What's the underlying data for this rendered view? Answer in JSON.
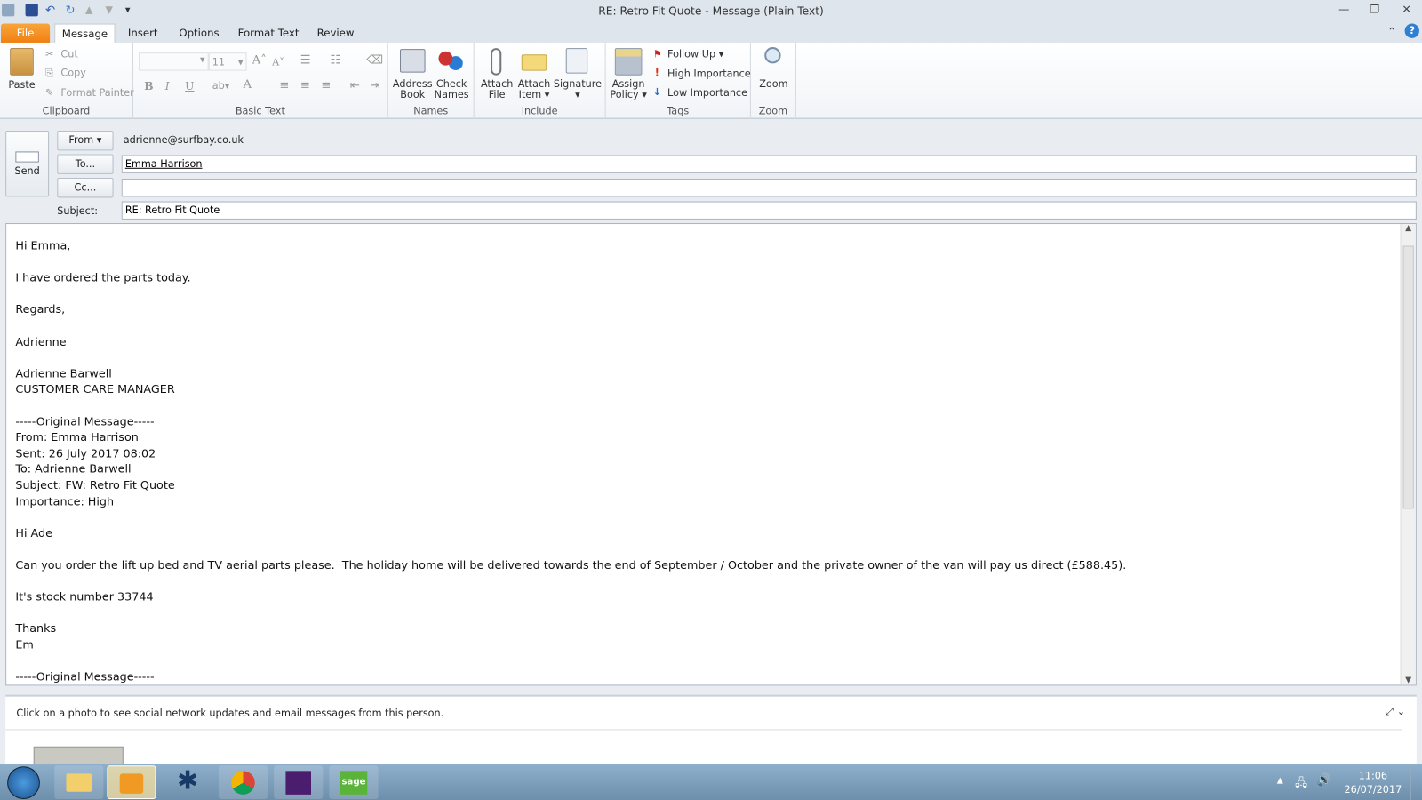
{
  "window": {
    "title": "RE: Retro Fit Quote  -  Message (Plain Text)"
  },
  "tabs": [
    {
      "label": "File"
    },
    {
      "label": "Message"
    },
    {
      "label": "Insert"
    },
    {
      "label": "Options"
    },
    {
      "label": "Format Text"
    },
    {
      "label": "Review"
    }
  ],
  "ribbon": {
    "clipboard": {
      "label": "Clipboard",
      "paste": "Paste",
      "cut": "Cut",
      "copy": "Copy",
      "format_painter": "Format Painter"
    },
    "basic_text": {
      "label": "Basic Text",
      "font_size": "11",
      "bold": "B",
      "italic": "I",
      "underline": "U",
      "font_color": "A"
    },
    "names": {
      "label": "Names",
      "address_book": [
        "Address",
        "Book"
      ],
      "check_names": [
        "Check",
        "Names"
      ]
    },
    "include": {
      "label": "Include",
      "attach_file": [
        "Attach",
        "File"
      ],
      "attach_item": [
        "Attach",
        "Item ▾"
      ],
      "signature": "Signature"
    },
    "tags": {
      "label": "Tags",
      "assign_policy": [
        "Assign",
        "Policy ▾"
      ],
      "follow_up": "Follow Up",
      "high_importance": "High Importance",
      "low_importance": "Low Importance"
    },
    "zoom": {
      "label": "Zoom",
      "zoom": "Zoom"
    }
  },
  "header": {
    "send": "Send",
    "from_button": "From ▾",
    "from_value": "adrienne@surfbay.co.uk",
    "to_button": "To...",
    "to_value": "Emma Harrison",
    "cc_button": "Cc...",
    "cc_value": "",
    "subject_label": "Subject:",
    "subject_value": "RE: Retro Fit Quote"
  },
  "body_lines": [
    "Hi Emma,",
    "",
    "I have ordered the parts today.",
    "",
    "Regards,",
    "",
    "Adrienne",
    "",
    "Adrienne Barwell",
    "CUSTOMER CARE MANAGER",
    "",
    "-----Original Message-----",
    "From: Emma Harrison",
    "Sent: 26 July 2017 08:02",
    "To: Adrienne Barwell",
    "Subject: FW: Retro Fit Quote",
    "Importance: High",
    "",
    "Hi Ade",
    "",
    "Can you order the lift up bed and TV aerial parts please.  The holiday home will be delivered towards the end of September / October and the private owner of the van will pay us direct (£588.45).",
    "",
    "It's stock number 33744",
    "",
    "Thanks",
    "Em",
    "",
    "-----Original Message-----"
  ],
  "people_pane": {
    "text": "Click on a photo to see social network updates and email messages from this person."
  },
  "taskbar": {
    "time": "11:06",
    "date": "26/07/2017",
    "apps": [
      "windows-explorer",
      "outlook",
      "app-figure",
      "chrome",
      "calendar-app",
      "sage"
    ]
  },
  "colors": {
    "file_tab": "#f08012",
    "taskbar": "#7f9fbc"
  }
}
